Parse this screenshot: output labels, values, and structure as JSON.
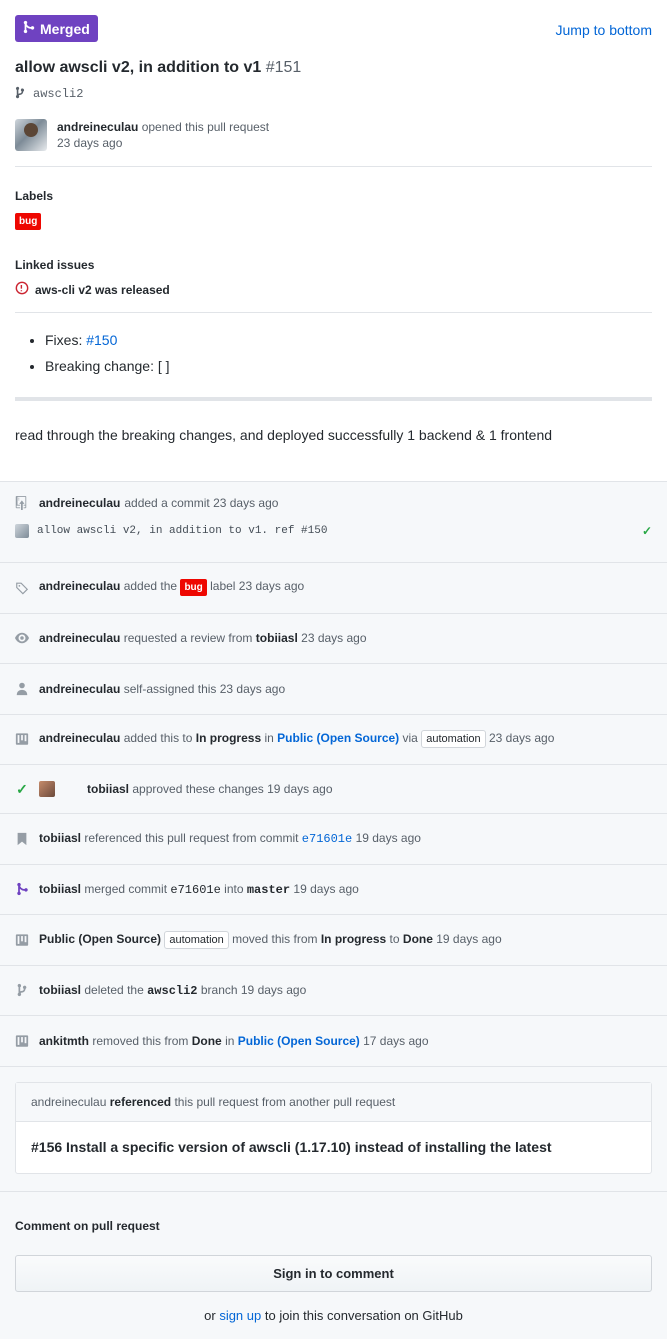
{
  "header": {
    "status_label": "Merged",
    "jump_label": "Jump to bottom",
    "title": "allow awscli v2, in addition to v1",
    "number": "#151",
    "branch": "awscli2"
  },
  "author": {
    "name": "andreineculau",
    "action": "opened this pull request",
    "time": "23 days ago"
  },
  "labels": {
    "title": "Labels",
    "items": [
      "bug"
    ],
    "color": "#ee0701"
  },
  "linked_issues": {
    "title": "Linked issues",
    "items": [
      "aws-cli v2 was released"
    ]
  },
  "body": {
    "fixes_label": "Fixes:",
    "fixes_link": "#150",
    "breaking_change": "Breaking change: [ ]",
    "paragraph": "read through the breaking changes, and deployed successfully 1 backend & 1 frontend"
  },
  "timeline": {
    "commit": {
      "user": "andreineculau",
      "action": "added a commit 23 days ago",
      "message": "allow awscli v2, in addition to v1. ref #150"
    },
    "label_event": {
      "user": "andreineculau",
      "pre": "added the",
      "label": "bug",
      "post": "label 23 days ago"
    },
    "review_event": {
      "user": "andreineculau",
      "pre": "requested a review from",
      "reviewer": "tobiiasl",
      "post": "23 days ago"
    },
    "assign_event": {
      "user": "andreineculau",
      "text": "self-assigned this 23 days ago"
    },
    "project_event": {
      "user": "andreineculau",
      "pre": "added this to",
      "column": "In progress",
      "in": "in",
      "project": "Public (Open Source)",
      "via": "via",
      "pill": "automation",
      "post": "23 days ago"
    },
    "approve_event": {
      "user": "tobiiasl",
      "text": "approved these changes 19 days ago"
    },
    "reference_event": {
      "user": "tobiiasl",
      "pre": "referenced this pull request from commit",
      "sha": "e71601e",
      "post": "19 days ago"
    },
    "merge_event": {
      "user": "tobiiasl",
      "pre": "merged commit",
      "sha": "e71601e",
      "into": "into",
      "branch": "master",
      "post": "19 days ago"
    },
    "move_event": {
      "actor": "Public (Open Source)",
      "pill": "automation",
      "pre": "moved this from",
      "from": "In progress",
      "to_word": "to",
      "to": "Done",
      "post": "19 days ago"
    },
    "delete_event": {
      "user": "tobiiasl",
      "pre": "deleted the",
      "branch": "awscli2",
      "post": "branch 19 days ago"
    },
    "remove_event": {
      "user": "ankitmth",
      "pre": "removed this from",
      "column": "Done",
      "in": "in",
      "project": "Public (Open Source)",
      "post": "17 days ago"
    }
  },
  "ref_card": {
    "user": "andreineculau",
    "action": "referenced",
    "rest": "this pull request from another pull request",
    "title": "#156 Install a specific version of awscli (1.17.10) instead of installing the latest"
  },
  "comment": {
    "title": "Comment on pull request",
    "button": "Sign in to comment",
    "pre": "or",
    "link": "sign up",
    "post": "to join this conversation on GitHub"
  }
}
